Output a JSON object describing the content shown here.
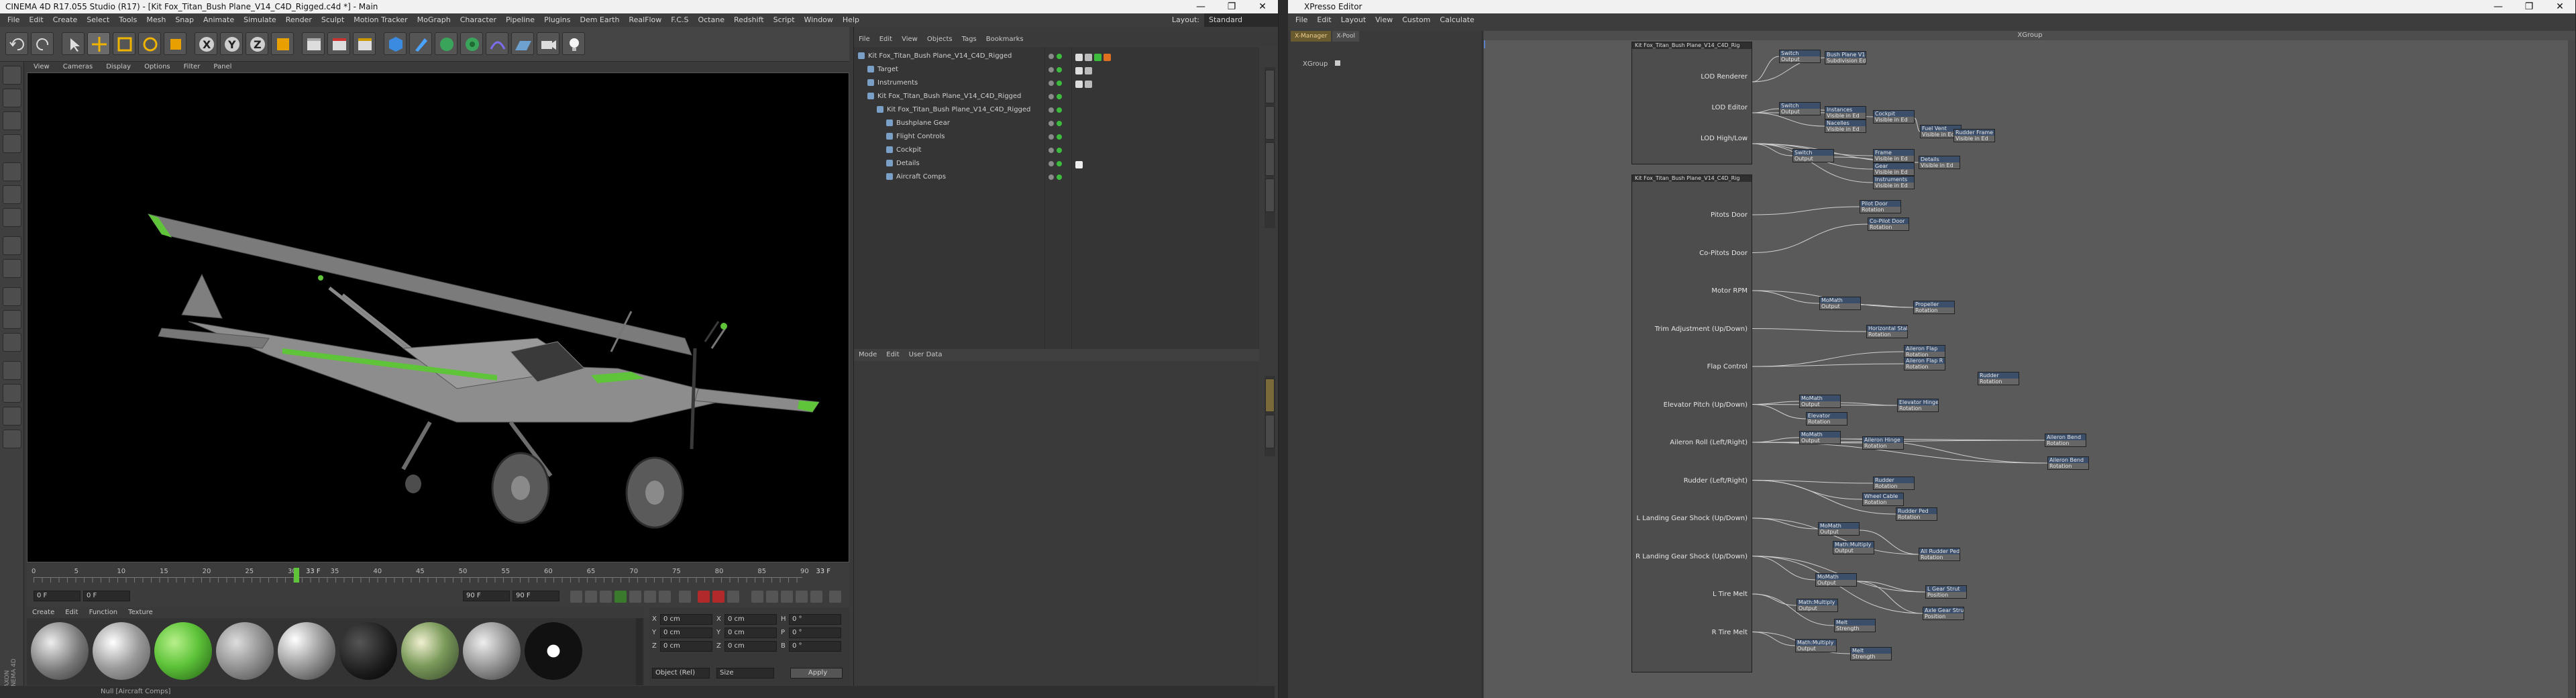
{
  "c4d": {
    "title": "CINEMA 4D R17.055 Studio (R17) - [Kit Fox_Titan_Bush Plane_V14_C4D_Rigged.c4d *] - Main",
    "window_controls": [
      "—",
      "❐",
      "✕"
    ],
    "menu": [
      "File",
      "Edit",
      "Create",
      "Select",
      "Tools",
      "Mesh",
      "Snap",
      "Animate",
      "Simulate",
      "Render",
      "Sculpt",
      "Motion Tracker",
      "MoGraph",
      "Character",
      "Pipeline",
      "Plugins",
      "Dem Earth",
      "RealFlow",
      "F.C.S",
      "Octane",
      "Redshift",
      "Script",
      "Window",
      "Help"
    ],
    "layout_label": "Layout:",
    "layout_value": "Standard",
    "viewport_menu": [
      "View",
      "Cameras",
      "Display",
      "Options",
      "Filter",
      "Panel"
    ],
    "timeline": {
      "ticks": [
        "0",
        "5",
        "10",
        "15",
        "20",
        "25",
        "30",
        "35",
        "40",
        "45",
        "50",
        "55",
        "60",
        "65",
        "70",
        "75",
        "80",
        "85",
        "90"
      ],
      "current_frame_label": "33 F",
      "end_label": "33 F",
      "start_field": "0 F",
      "min_field": "0 F",
      "max_field": "90 F",
      "end_field": "90 F"
    },
    "material_menu": [
      "Create",
      "Edit",
      "Function",
      "Texture"
    ],
    "coords": {
      "rows": [
        {
          "a": "X",
          "av": "0 cm",
          "b": "X",
          "bv": "0 cm",
          "c": "H",
          "cv": "0 °"
        },
        {
          "a": "Y",
          "av": "0 cm",
          "b": "Y",
          "bv": "0 cm",
          "c": "P",
          "cv": "0 °"
        },
        {
          "a": "Z",
          "av": "0 cm",
          "b": "Z",
          "bv": "0 cm",
          "c": "B",
          "cv": "0 °"
        }
      ],
      "mode": "Object (Rel)",
      "size": "Size",
      "apply": "Apply"
    },
    "status": "Null [Aircraft Comps]",
    "side_label": "MAXON CINEMA 4D"
  },
  "object_manager": {
    "menu": [
      "File",
      "Edit",
      "View",
      "Objects",
      "Tags",
      "Bookmarks"
    ],
    "rows": [
      {
        "label": "Kit Fox_Titan_Bush Plane_V14_C4D_Rigged",
        "indent": 0
      },
      {
        "label": "Target",
        "indent": 1
      },
      {
        "label": "Instruments",
        "indent": 1
      },
      {
        "label": "Kit Fox_Titan_Bush Plane_V14_C4D_Rigged",
        "indent": 1
      },
      {
        "label": "Kit Fox_Titan_Bush Plane_V14_C4D_Rigged",
        "indent": 2
      },
      {
        "label": "Bushplane Gear",
        "indent": 3
      },
      {
        "label": "Flight Controls",
        "indent": 3
      },
      {
        "label": "Cockpit",
        "indent": 3
      },
      {
        "label": "Details",
        "indent": 3
      },
      {
        "label": "Aircraft Comps",
        "indent": 3
      }
    ]
  },
  "attribute_manager": {
    "menu": [
      "Mode",
      "Edit",
      "User Data"
    ]
  },
  "xpresso": {
    "title": "XPresso Editor",
    "window_controls": [
      "—",
      "❐",
      "✕"
    ],
    "menu": [
      "File",
      "Edit",
      "Layout",
      "View",
      "Custom",
      "Calculate"
    ],
    "tabs": [
      "X-Manager",
      "X-Pool"
    ],
    "tree_item": "XGroup",
    "canvas_title": "XGroup",
    "panel_top": {
      "title": "Kit Fox_Titan_Bush Plane_V14_C4D_Rig",
      "ports": [
        "LOD Renderer",
        "LOD Editor",
        "LOD High/Low"
      ]
    },
    "panel_bottom": {
      "title": "Kit Fox_Titan_Bush Plane_V14_C4D_Rig",
      "ports": [
        "Pitots Door",
        "Co-Pitots Door",
        "Motor RPM",
        "Trim Adjustment (Up/Down)",
        "Flap Control",
        "Elevator Pitch (Up/Down)",
        "Aileron Roll (Left/Right)",
        "Rudder (Left/Right)",
        "L Landing Gear Shock (Up/Down)",
        "R Landing Gear Shock (Up/Down)",
        "L Tire Melt",
        "R Tire Melt"
      ]
    },
    "nodes": [
      {
        "t": "Switch",
        "b": "Output"
      },
      {
        "t": "Bush Plane V14",
        "b": "Subdivision Ed"
      },
      {
        "t": "Switch",
        "b": "Output"
      },
      {
        "t": "Instances",
        "b": "Visible in Ed"
      },
      {
        "t": "Nacelles",
        "b": "Visible in Ed"
      },
      {
        "t": "Cockpit",
        "b": "Visible in Ed"
      },
      {
        "t": "Fuel Vent",
        "b": "Visible in Ed"
      },
      {
        "t": "Rudder Frame",
        "b": "Visible in Ed"
      },
      {
        "t": "Switch",
        "b": "Output"
      },
      {
        "t": "Frame",
        "b": "Visible in Ed"
      },
      {
        "t": "Gear",
        "b": "Visible in Ed"
      },
      {
        "t": "Details",
        "b": "Visible in Ed"
      },
      {
        "t": "Instruments",
        "b": "Visible in Ed"
      },
      {
        "t": "Pilot Door",
        "b": "Rotation"
      },
      {
        "t": "Co-Pilot Door",
        "b": "Rotation"
      },
      {
        "t": "MoMath",
        "b": "Output"
      },
      {
        "t": "Propeller",
        "b": "Rotation"
      },
      {
        "t": "Horizontal Stab",
        "b": "Rotation"
      },
      {
        "t": "Aileron Flap",
        "b": "Rotation"
      },
      {
        "t": "Aileron Flap R",
        "b": "Rotation"
      },
      {
        "t": "Rudder",
        "b": "Rotation"
      },
      {
        "t": "MoMath",
        "b": "Output"
      },
      {
        "t": "Elevator",
        "b": "Rotation"
      },
      {
        "t": "Elevator Hinge",
        "b": "Rotation"
      },
      {
        "t": "Aileron Hinge",
        "b": "Rotation"
      },
      {
        "t": "MoMath",
        "b": "Output"
      },
      {
        "t": "Aileron Bend",
        "b": "Rotation"
      },
      {
        "t": "Aileron Bend",
        "b": "Rotation"
      },
      {
        "t": "Rudder",
        "b": "Rotation"
      },
      {
        "t": "Wheel Cable",
        "b": "Rotation"
      },
      {
        "t": "Rudder Ped",
        "b": "Rotation"
      },
      {
        "t": "MoMath",
        "b": "Output"
      },
      {
        "t": "Math:Multiply",
        "b": "Output"
      },
      {
        "t": "All Rudder Ped",
        "b": "Rotation"
      },
      {
        "t": "MoMath",
        "b": "Output"
      },
      {
        "t": "L Gear Strut",
        "b": "Position"
      },
      {
        "t": "Axle Gear Strut",
        "b": "Position"
      },
      {
        "t": "Math:Multiply",
        "b": "Output"
      },
      {
        "t": "Melt",
        "b": "Strength"
      },
      {
        "t": "Math:Multiply",
        "b": "Output"
      },
      {
        "t": "Melt",
        "b": "Strength"
      }
    ]
  },
  "colors": {
    "accent_green": "#5fc43a",
    "selection_orange": "#d98a1a",
    "node_blue": "#3b4f6b"
  }
}
